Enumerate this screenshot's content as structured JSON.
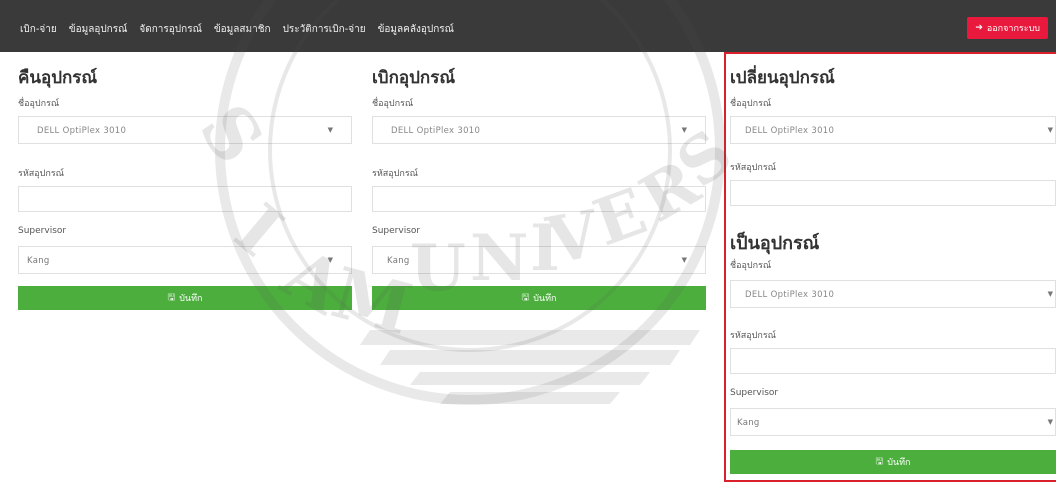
{
  "nav": {
    "links": [
      "เบิก-จ่าย",
      "ข้อมูลอุปกรณ์",
      "จัดการอุปกรณ์",
      "ข้อมูลสมาชิก",
      "ประวัติการเบิก-จ่าย",
      "ข้อมูลคลังอุปกรณ์"
    ],
    "logout_label": "ออกจากระบบ"
  },
  "return_panel": {
    "title": "คืนอุปกรณ์",
    "device_label": "ชื่ออุปกรณ์",
    "device_value": "DELL OptiPlex 3010",
    "code_label": "รหัสอุปกรณ์",
    "code_value": "",
    "supervisor_label": "Supervisor",
    "supervisor_value": "Kang",
    "save_label": "บันทึก"
  },
  "borrow_panel": {
    "title": "เบิกอุปกรณ์",
    "device_label": "ชื่ออุปกรณ์",
    "device_value": "DELL OptiPlex 3010",
    "code_label": "รหัสอุปกรณ์",
    "code_value": "",
    "supervisor_label": "Supervisor",
    "supervisor_value": "Kang",
    "save_label": "บันทึก"
  },
  "swap_panel": {
    "title": "เปลี่ยนอุปกรณ์",
    "device_label": "ชื่ออุปกรณ์",
    "device_value": "DELL OptiPlex 3010",
    "code_label": "รหัสอุปกรณ์",
    "code_value": "",
    "to_title": "เป็นอุปกรณ์",
    "to_device_label": "ชื่ออุปกรณ์",
    "to_device_value": "DELL OptiPlex 3010",
    "to_code_label": "รหัสอุปกรณ์",
    "to_code_value": "",
    "supervisor_label": "Supervisor",
    "supervisor_value": "Kang",
    "save_label": "บันทึก"
  },
  "watermark_text": "SIAM UNIVERSITY"
}
